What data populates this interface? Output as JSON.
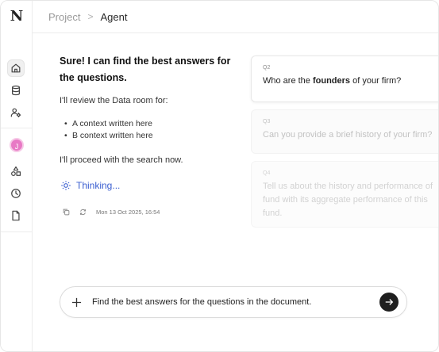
{
  "sidebar": {
    "logo": "N",
    "items": [
      {
        "icon": "home-icon"
      },
      {
        "icon": "database-icon"
      },
      {
        "icon": "user-settings-icon"
      },
      {
        "icon": "shapes-icon"
      },
      {
        "icon": "clock-icon"
      },
      {
        "icon": "document-icon"
      }
    ],
    "avatar_initial": "J"
  },
  "header": {
    "project": "Project",
    "separator": ">",
    "current": "Agent"
  },
  "message": {
    "title": "Sure! I can find the best answers for the questions.",
    "intro": "I'll review the Data room for:",
    "bullets": [
      "A context written here",
      "B context written here"
    ],
    "outro": "I'll proceed with the search now.",
    "thinking": "Thinking...",
    "timestamp": "Mon 13 Oct 2025, 16:54"
  },
  "questions": [
    {
      "num": "Q2",
      "text_before": "Who are the ",
      "bold": "founders",
      "text_after": " of your firm?"
    },
    {
      "num": "Q3",
      "text": "Can you provide a brief history of your firm?"
    },
    {
      "num": "Q4",
      "text": "Tell us about the history and performance of fund with its aggregate performance of this fund."
    }
  ],
  "composer": {
    "value": "Find the best answers for the questions in the document."
  },
  "colors": {
    "accent": "#3b5fd0",
    "avatar": "#e879c5",
    "send_button": "#1f1f1f"
  }
}
